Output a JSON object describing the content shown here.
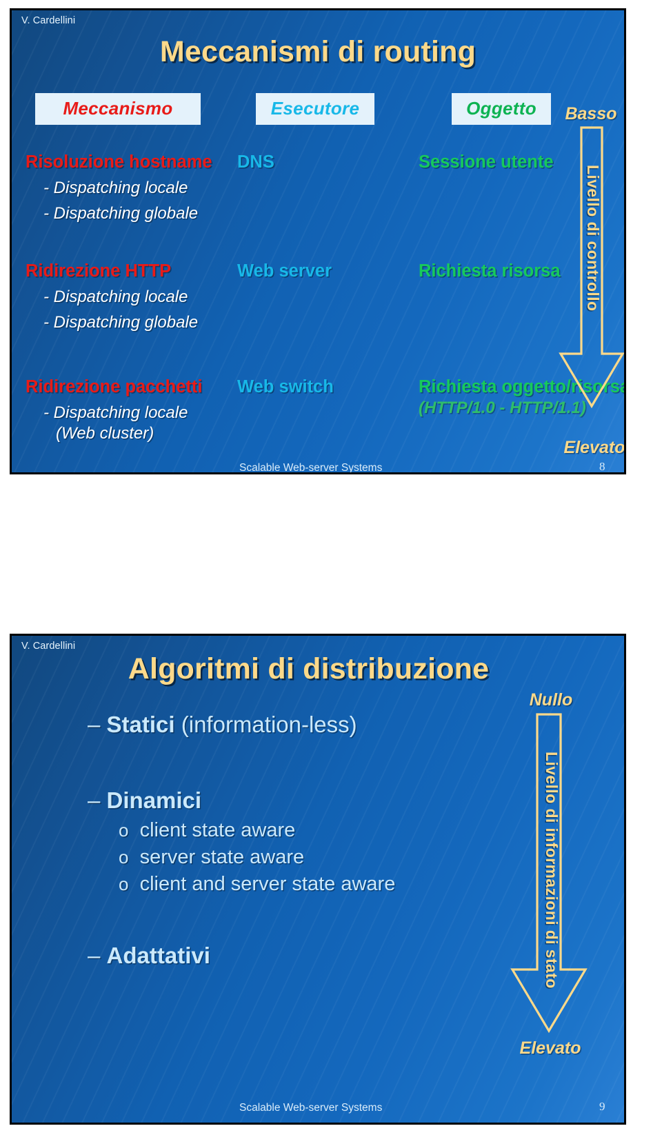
{
  "slide1": {
    "author": "V. Cardellini",
    "title": "Meccanismi di routing",
    "headers": {
      "mechanism": "Meccanismo",
      "executor": "Esecutore",
      "object": "Oggetto"
    },
    "rows": [
      {
        "mechanism": "Risoluzione hostname",
        "sub": [
          "- Dispatching locale",
          "- Dispatching globale"
        ],
        "executor": "DNS",
        "object": "Sessione utente",
        "object_sub": ""
      },
      {
        "mechanism": "Ridirezione HTTP",
        "sub": [
          "- Dispatching locale",
          "- Dispatching globale"
        ],
        "executor": "Web server",
        "object": "Richiesta risorsa",
        "object_sub": ""
      },
      {
        "mechanism": "Ridirezione pacchetti",
        "sub": [
          "- Dispatching locale",
          "(Web cluster)"
        ],
        "executor": "Web switch",
        "object": "Richiesta oggetto/risorsa",
        "object_sub": "(HTTP/1.0 - HTTP/1.1)"
      }
    ],
    "arrow": {
      "top_label": "Basso",
      "axis_label": "Livello di controllo",
      "bottom_label": "Elevato"
    },
    "footer": {
      "text": "Scalable Web-server Systems",
      "page": "8"
    }
  },
  "slide2": {
    "author": "V. Cardellini",
    "title": "Algoritmi di distribuzione",
    "bullets": [
      {
        "dash": "–",
        "strong": "Statici",
        "rest": " (information-less)"
      },
      {
        "dash": "–",
        "strong": "Dinamici",
        "rest": ""
      }
    ],
    "sub_bullets": [
      {
        "marker": "o",
        "text": "client state aware"
      },
      {
        "marker": "o",
        "text": "server state aware"
      },
      {
        "marker": "o",
        "text": "client and server state aware"
      }
    ],
    "bullet_last": {
      "dash": "–",
      "strong": "Adattativi",
      "rest": ""
    },
    "arrow": {
      "top_label": "Nullo",
      "axis_label": "Livello di informazioni di stato",
      "bottom_label": "Elevato"
    },
    "footer": {
      "text": "Scalable Web-server Systems",
      "page": "9"
    }
  },
  "colors": {
    "title": "#fcd98a",
    "mechanism": "#e81b18",
    "executor": "#18b8e8",
    "object": "#17c95c",
    "background_start": "#11487f",
    "background_end": "#2a7fd4",
    "chip_bg": "#e4f2fb",
    "arrow_stroke": "#fcd98a"
  }
}
